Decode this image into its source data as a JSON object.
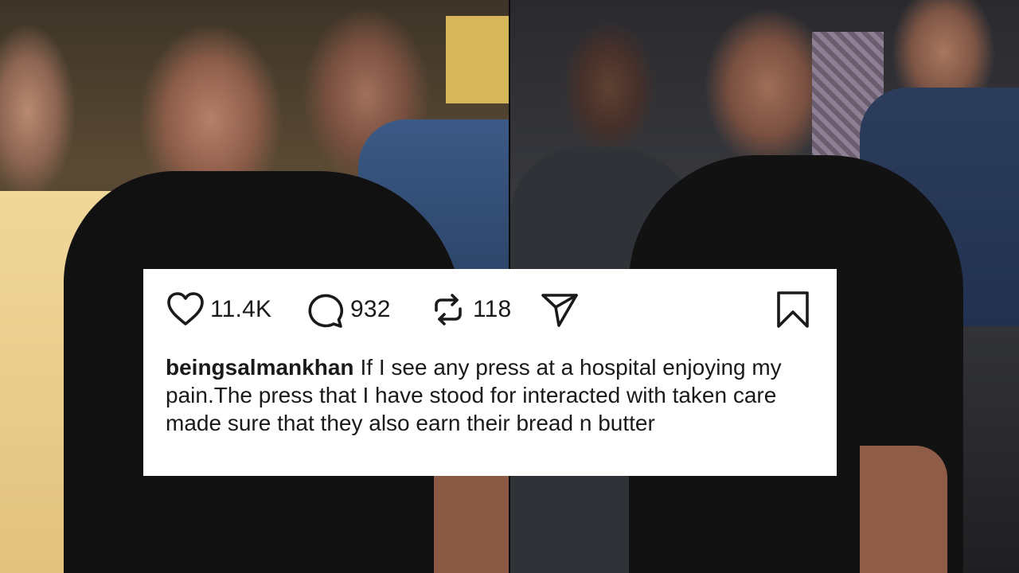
{
  "post": {
    "actions": {
      "likes": "11.4K",
      "comments": "932",
      "reposts": "118"
    },
    "caption": {
      "username": "beingsalmankhan",
      "text": "If I see any press at a hospital enjoying my pain.The press that I have stood for interacted with taken care made sure that they also earn their bread n butter"
    }
  },
  "icons": {
    "like": "heart-icon",
    "comment": "comment-bubble-icon",
    "repost": "repost-icon",
    "share": "send-icon",
    "save": "bookmark-icon"
  },
  "colors": {
    "card_background": "#ffffff",
    "text": "#1a1a1a",
    "icon_stroke": "#1a1a1a"
  }
}
